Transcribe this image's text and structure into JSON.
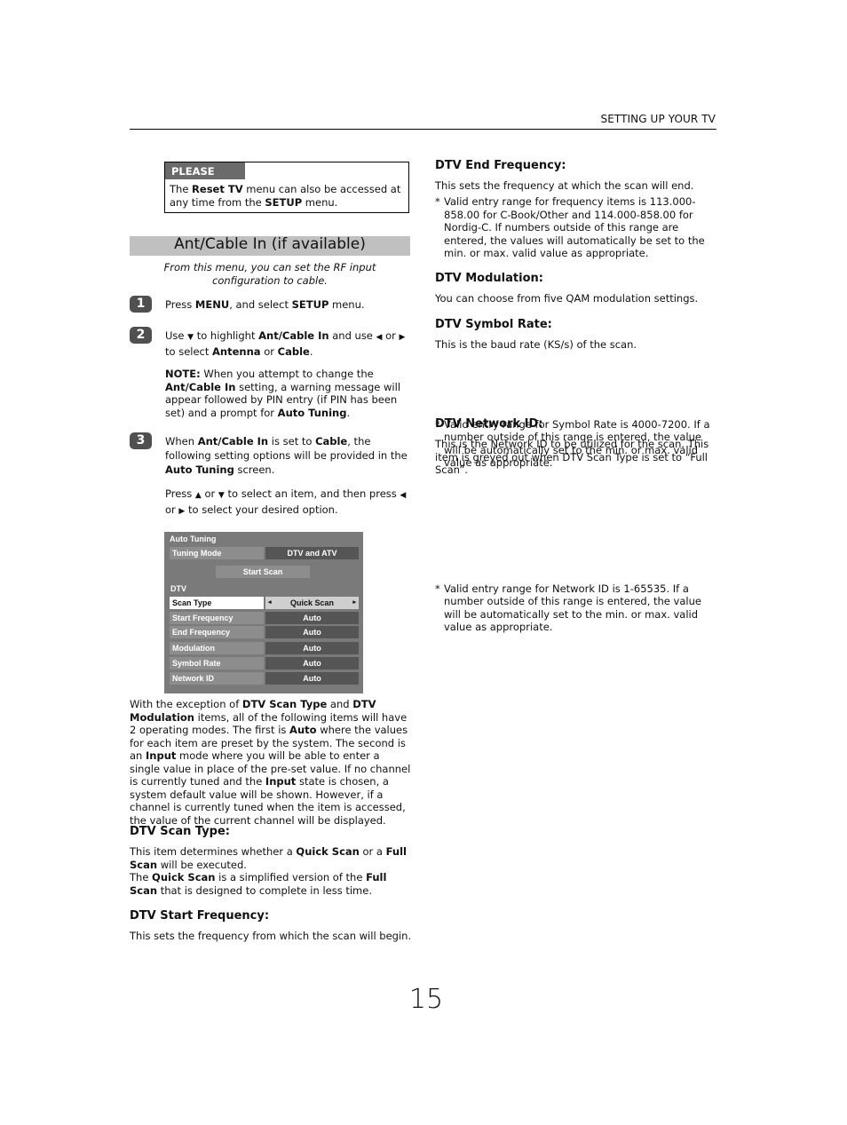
{
  "header": {
    "section": "SETTING UP YOUR TV"
  },
  "please_note": {
    "tag": "PLEASE NOTE",
    "t1": "The ",
    "b1": "Reset TV",
    "t2": " menu can also be accessed at any time from the ",
    "b2": "SETUP",
    "t3": " menu."
  },
  "section": {
    "title": "Ant/Cable In (if available)",
    "intro": "From this menu, you can set the RF input configuration to cable."
  },
  "steps": [
    {
      "num": "1",
      "t1": "Press ",
      "b1": "MENU",
      "t2": ", and select ",
      "b2": "SETUP",
      "t3": " menu."
    },
    {
      "num": "2",
      "t1": "Use ",
      "i1": "▼",
      "t2": " to highlight ",
      "b1": "Ant/Cable In",
      "t3": " and use ",
      "i2": "◀",
      "t4": " or ",
      "i3": "▶",
      "t5": " to select ",
      "b2": "Antenna",
      "t6": " or ",
      "b3": "Cable",
      "t7": ".",
      "note": {
        "b1": "NOTE:",
        "t1": " When you attempt to change the ",
        "b2": "Ant/Cable In",
        "t2": " setting, a warning message will appear followed by PIN entry (if PIN has been set) and a prompt for ",
        "b3": "Auto Tuning",
        "t3": "."
      }
    },
    {
      "num": "3",
      "t1": "When ",
      "b1": "Ant/Cable In",
      "t2": " is set to ",
      "b2": "Cable",
      "t3": ", the following setting options will be provided in the ",
      "b3": "Auto Tuning",
      "t4": " screen.",
      "press": {
        "t1": "Press ",
        "i1": "▲",
        "t2": " or ",
        "i2": "▼",
        "t3": " to select an item, and then press ",
        "i3": "◀",
        "t4": " or ",
        "i4": "▶",
        "t5": " to select your desired option."
      }
    }
  ],
  "menu": {
    "title": "Auto Tuning",
    "tuning_mode": {
      "label": "Tuning Mode",
      "value": "DTV and ATV"
    },
    "start_scan": "Start Scan",
    "group": "DTV",
    "scan_type": {
      "label": "Scan Type",
      "value": "Quick Scan",
      "left": "◂",
      "right": "▸"
    },
    "rows": [
      {
        "label": "Start Frequency",
        "value": "Auto"
      },
      {
        "label": "End Frequency",
        "value": "Auto"
      },
      {
        "label": "Modulation",
        "value": "Auto"
      },
      {
        "label": "Symbol Rate",
        "value": "Auto"
      },
      {
        "label": "Network ID",
        "value": "Auto"
      }
    ]
  },
  "body": {
    "t1": "With the exception of ",
    "b1": "DTV Scan Type",
    "t2": " and ",
    "b2": "DTV Modulation",
    "t3": " items, all of the following items will have 2 operating modes. The first is ",
    "b3": "Auto",
    "t4": " where the values for each item are preset by the system. The second is an ",
    "b4": "Input",
    "t5": " mode where you will be able to enter a single value in place of the pre-set value. If no channel is currently tuned and the ",
    "b5": "Input",
    "t6": " state is chosen, a system default value will be shown. However, if a channel is currently tuned when the item is accessed, the value of the current channel will be displayed."
  },
  "scan_type": {
    "heading": "DTV Scan Type:",
    "t1": "This item determines whether a ",
    "b1": "Quick Scan",
    "t2": " or a ",
    "b2": "Full Scan",
    "t3": " will be executed.",
    "t4": "The ",
    "b3": "Quick Scan",
    "t5": " is a simplified version of the ",
    "b4": "Full Scan",
    "t6": " that is designed to complete in less time."
  },
  "start_freq": {
    "heading": "DTV Start Frequency:",
    "text": "This sets the frequency from which the scan will begin."
  },
  "end_freq": {
    "heading": "DTV End Frequency:",
    "text": "This sets the frequency at which the scan will end.",
    "star": "*",
    "bullet": "Valid entry range for frequency items is 113.000-858.00 for C-Book/Other and 114.000-858.00 for Nordig-C. If numbers outside of this range are entered, the values will automatically be set to the min. or max. valid value as appropriate."
  },
  "modulation": {
    "heading": "DTV Modulation:",
    "text": "You can choose from five QAM modulation settings."
  },
  "symbol_rate": {
    "heading": "DTV Symbol Rate:",
    "text": "This is the baud rate (KS/s) of the scan.",
    "star": "*",
    "bullet": "Valid entry range for Symbol Rate is 4000-7200. If a number outside of this range is entered, the value will be automatically set to the min. or max. valid value as appropriate."
  },
  "network_id": {
    "heading": "DTV Network ID:",
    "text": "This is the Network ID to be utilized for the scan. This item is greyed out when DTV Scan Type is set to “Full Scan”.",
    "star": "*",
    "bullet": "Valid entry range for Network ID is 1-65535. If a number outside of this range is entered, the value will be automatically set to the min. or max. valid value as appropriate."
  },
  "page_number": "15"
}
